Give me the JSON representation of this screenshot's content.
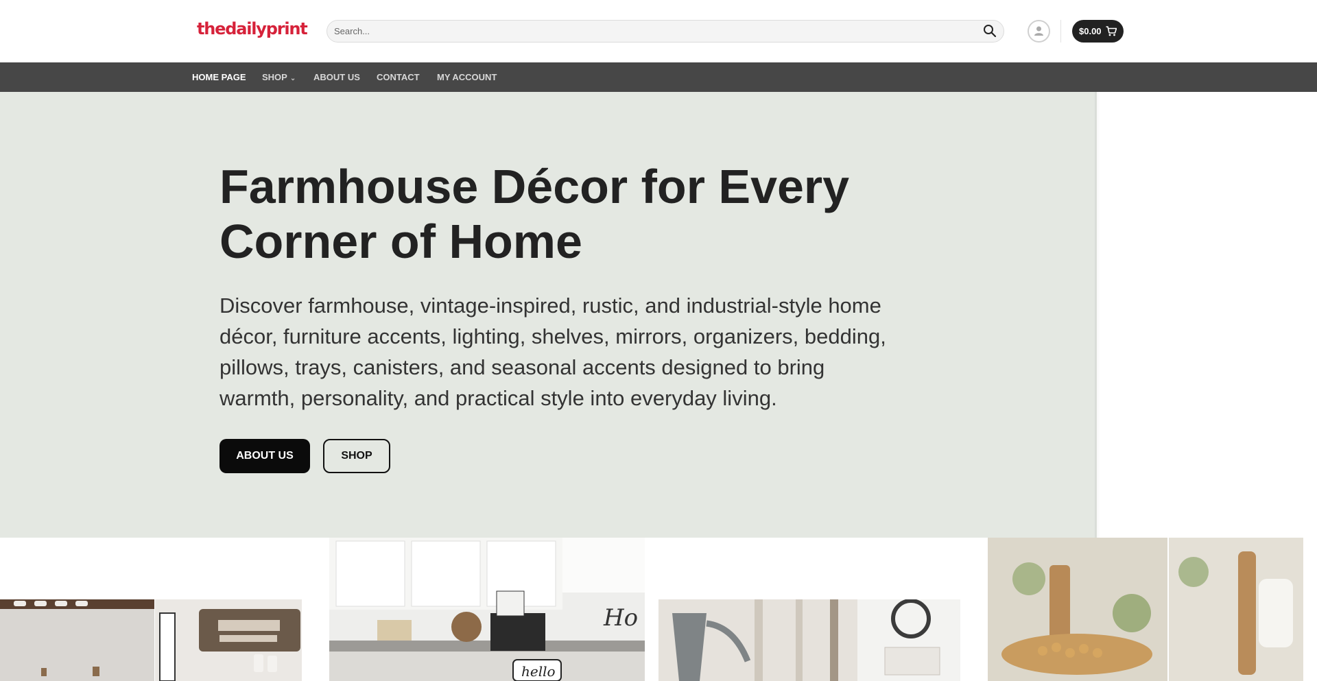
{
  "header": {
    "logo": "thedailyprint",
    "search_placeholder": "Search...",
    "cart_total": "$0.00"
  },
  "nav": {
    "items": [
      {
        "label": "HOME PAGE"
      },
      {
        "label": "SHOP"
      },
      {
        "label": "ABOUT US"
      },
      {
        "label": "CONTACT"
      },
      {
        "label": "MY ACCOUNT"
      }
    ]
  },
  "hero": {
    "title": "Farmhouse Décor for Every Corner of Home",
    "description": "Discover farmhouse, vintage-inspired, rustic, and industrial-style home décor, furniture accents, lighting, shelves, mirrors, organizers, bedding, pillows, trays, canisters, and seasonal accents designed to bring warmth, personality, and practical style into everyday living.",
    "primary_button": "ABOUT US",
    "secondary_button": "SHOP"
  },
  "colors": {
    "brand": "#d6223a",
    "nav_bg": "#474747",
    "hero_bg": "#e4e8e2"
  },
  "icons": [
    "search-icon",
    "user-icon",
    "cart-icon",
    "chevron-down-icon"
  ]
}
